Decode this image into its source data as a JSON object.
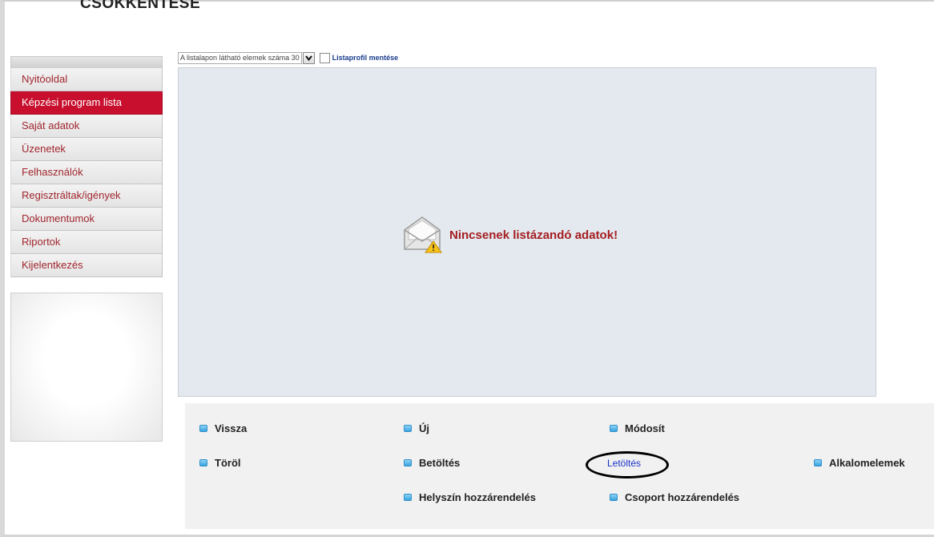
{
  "header": {
    "partial_title": "CSOKKENTÉSE"
  },
  "sidebar": {
    "items": [
      {
        "label": "Nyitóoldal"
      },
      {
        "label": "Képzési program lista"
      },
      {
        "label": "Saját adatok"
      },
      {
        "label": "Üzenetek"
      },
      {
        "label": "Felhasználók"
      },
      {
        "label": "Regisztráltak/igények"
      },
      {
        "label": "Dokumentumok"
      },
      {
        "label": "Riportok"
      },
      {
        "label": "Kijelentkezés"
      }
    ],
    "active_index": 1
  },
  "list_controls": {
    "page_size_label": "A listalapon látható elemek száma 30",
    "page_size_value": "30",
    "profile_save_prefix": "Listaprofil",
    "profile_save_suffix": "mentése"
  },
  "main": {
    "empty_message": "Nincsenek listázandó adatok!",
    "empty_icon": "envelope-warning-icon"
  },
  "actions": {
    "back": "Vissza",
    "new": "Új",
    "modify": "Módosít",
    "delete": "Töröl",
    "load": "Betöltés",
    "download": "Letöltés",
    "occasion_items": "Alkalomelemek",
    "assign_location": "Helyszín hozzárendelés",
    "assign_group": "Csoport hozzárendelés"
  },
  "colors": {
    "active_nav": "#c8102e",
    "nav_text": "#a0262e",
    "panel_bg": "#e3e9ee",
    "link_blue": "#1a33c9",
    "empty_text": "#a51e22"
  }
}
